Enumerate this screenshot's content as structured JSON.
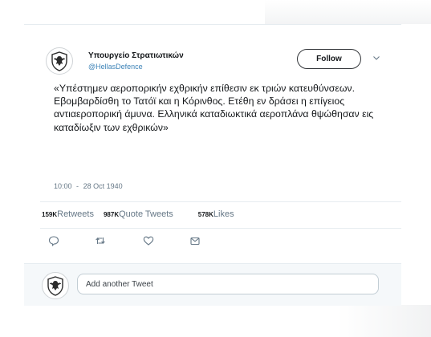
{
  "account": {
    "display_name": "Υπουργείο Στρατιωτικών",
    "handle": "@HellasDefence",
    "avatar_icon": "greek-army-emblem-icon"
  },
  "header": {
    "follow_label": "Follow",
    "menu_icon": "chevron-down-icon"
  },
  "tweet": {
    "text": "«Υπέστημεν αεροπορικήν εχθρικήν επίθεσιν εκ τριών κατευθύνσεων. Εβομβαρδίσθη το Τατόϊ και η Κόρινθος. Ετέθη εν δράσει η επίγειος αντιαεροπορική άμυνα. Ελληνικά καταδιωκτικά αεροπλάνα θψώθησαν εις καταδίωξιν των εχθρικών»",
    "time": "10:00",
    "separator": "-",
    "date": "28 Oct 1940"
  },
  "stats": {
    "retweets_count": "159K",
    "retweets_label": "Retweets",
    "quote_count": "987K",
    "quote_label": "Quote Tweets",
    "likes_count": "578K",
    "likes_label": "Likes"
  },
  "actions": [
    {
      "name": "reply-icon"
    },
    {
      "name": "retweet-icon"
    },
    {
      "name": "like-icon"
    },
    {
      "name": "share-icon"
    }
  ],
  "reply": {
    "placeholder": "Add another Tweet"
  },
  "colors": {
    "link": "#3d83b7",
    "muted": "#657786",
    "text": "#14171a",
    "icon": "#657786",
    "reply_bg": "#f5f8fa"
  }
}
